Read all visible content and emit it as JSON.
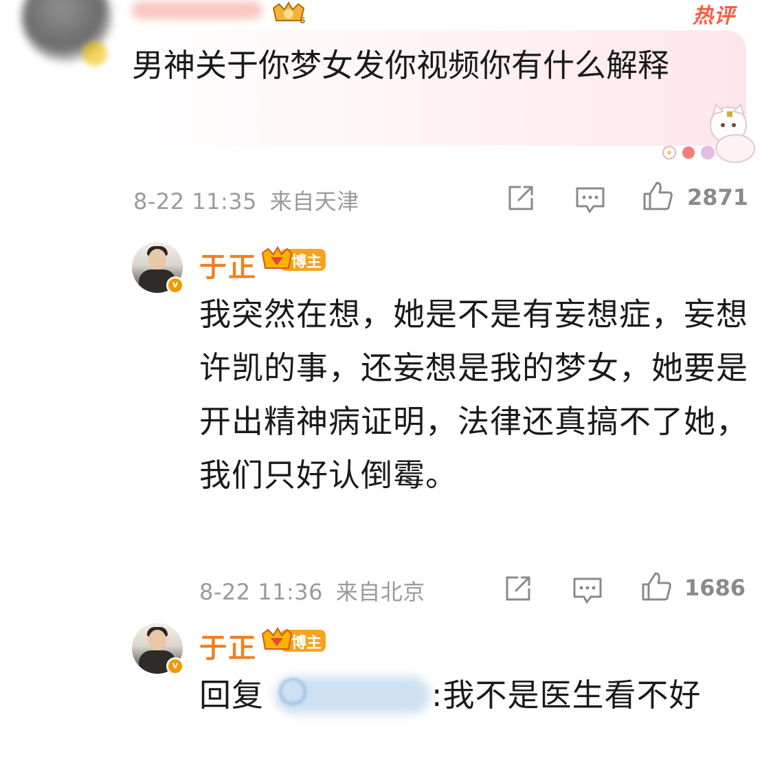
{
  "top_comment": {
    "hot_label": "热评",
    "level": "6",
    "text": "男神关于你梦女发你视频你有什么解释",
    "time": "8-22 11:35",
    "location": "来自天津",
    "likes": "2871"
  },
  "replies": [
    {
      "username": "于正",
      "badge_label": "博主",
      "badge_level": "7",
      "text": "我突然在想，她是不是有妄想症，妄想许凯的事，还妄想是我的梦女，她要是开出精神病证明，法律还真搞不了她，我们只好认倒霉。",
      "time": "8-22 11:36",
      "location": "来自北京",
      "likes": "1686"
    },
    {
      "username": "于正",
      "badge_label": "博主",
      "badge_level": "7",
      "reply_prefix": "回复",
      "text_after_mention": ":我不是医生看不好"
    }
  ],
  "icons": [
    "share-icon",
    "comment-icon",
    "like-icon",
    "verified-icon",
    "crown-icon"
  ],
  "colors": {
    "username": "#f08020",
    "hot": "#ff5a40",
    "meta": "#9a9a9a",
    "bubble": "#ffe6ea",
    "verified": "#f39800"
  }
}
